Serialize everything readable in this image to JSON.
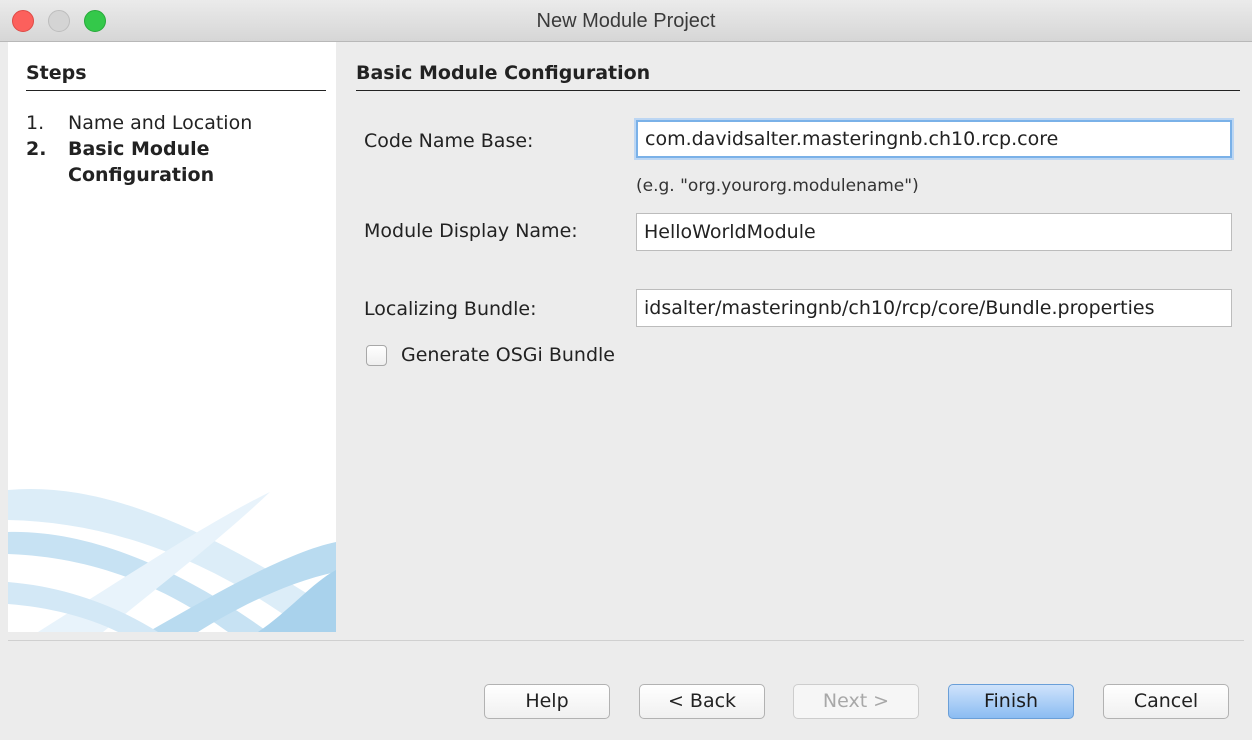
{
  "window": {
    "title": "New Module Project"
  },
  "steps": {
    "header": "Steps",
    "items": [
      {
        "number": "1.",
        "label": "Name and Location",
        "current": false
      },
      {
        "number": "2.",
        "label": "Basic Module Configuration",
        "current": true
      }
    ]
  },
  "main": {
    "section_title": "Basic Module Configuration",
    "code_name_base": {
      "label": "Code Name Base:",
      "value": "com.davidsalter.masteringnb.ch10.rcp.core",
      "hint": "(e.g. \"org.yourorg.modulename\")"
    },
    "display_name": {
      "label": "Module Display Name:",
      "value": "HelloWorldModule"
    },
    "localizing_bundle": {
      "label": "Localizing Bundle:",
      "value": "idsalter/masteringnb/ch10/rcp/core/Bundle.properties"
    },
    "osgi_checkbox": {
      "label": "Generate OSGi Bundle",
      "checked": false
    }
  },
  "buttons": {
    "help": "Help",
    "back": "< Back",
    "next": "Next >",
    "finish": "Finish",
    "cancel": "Cancel"
  },
  "colors": {
    "close": "#fc605c",
    "minimize_disabled": "#d4d4d4",
    "maximize": "#34c84a",
    "focus_ring": "#7ab1e8",
    "primary_button": "#8bbcf2"
  }
}
